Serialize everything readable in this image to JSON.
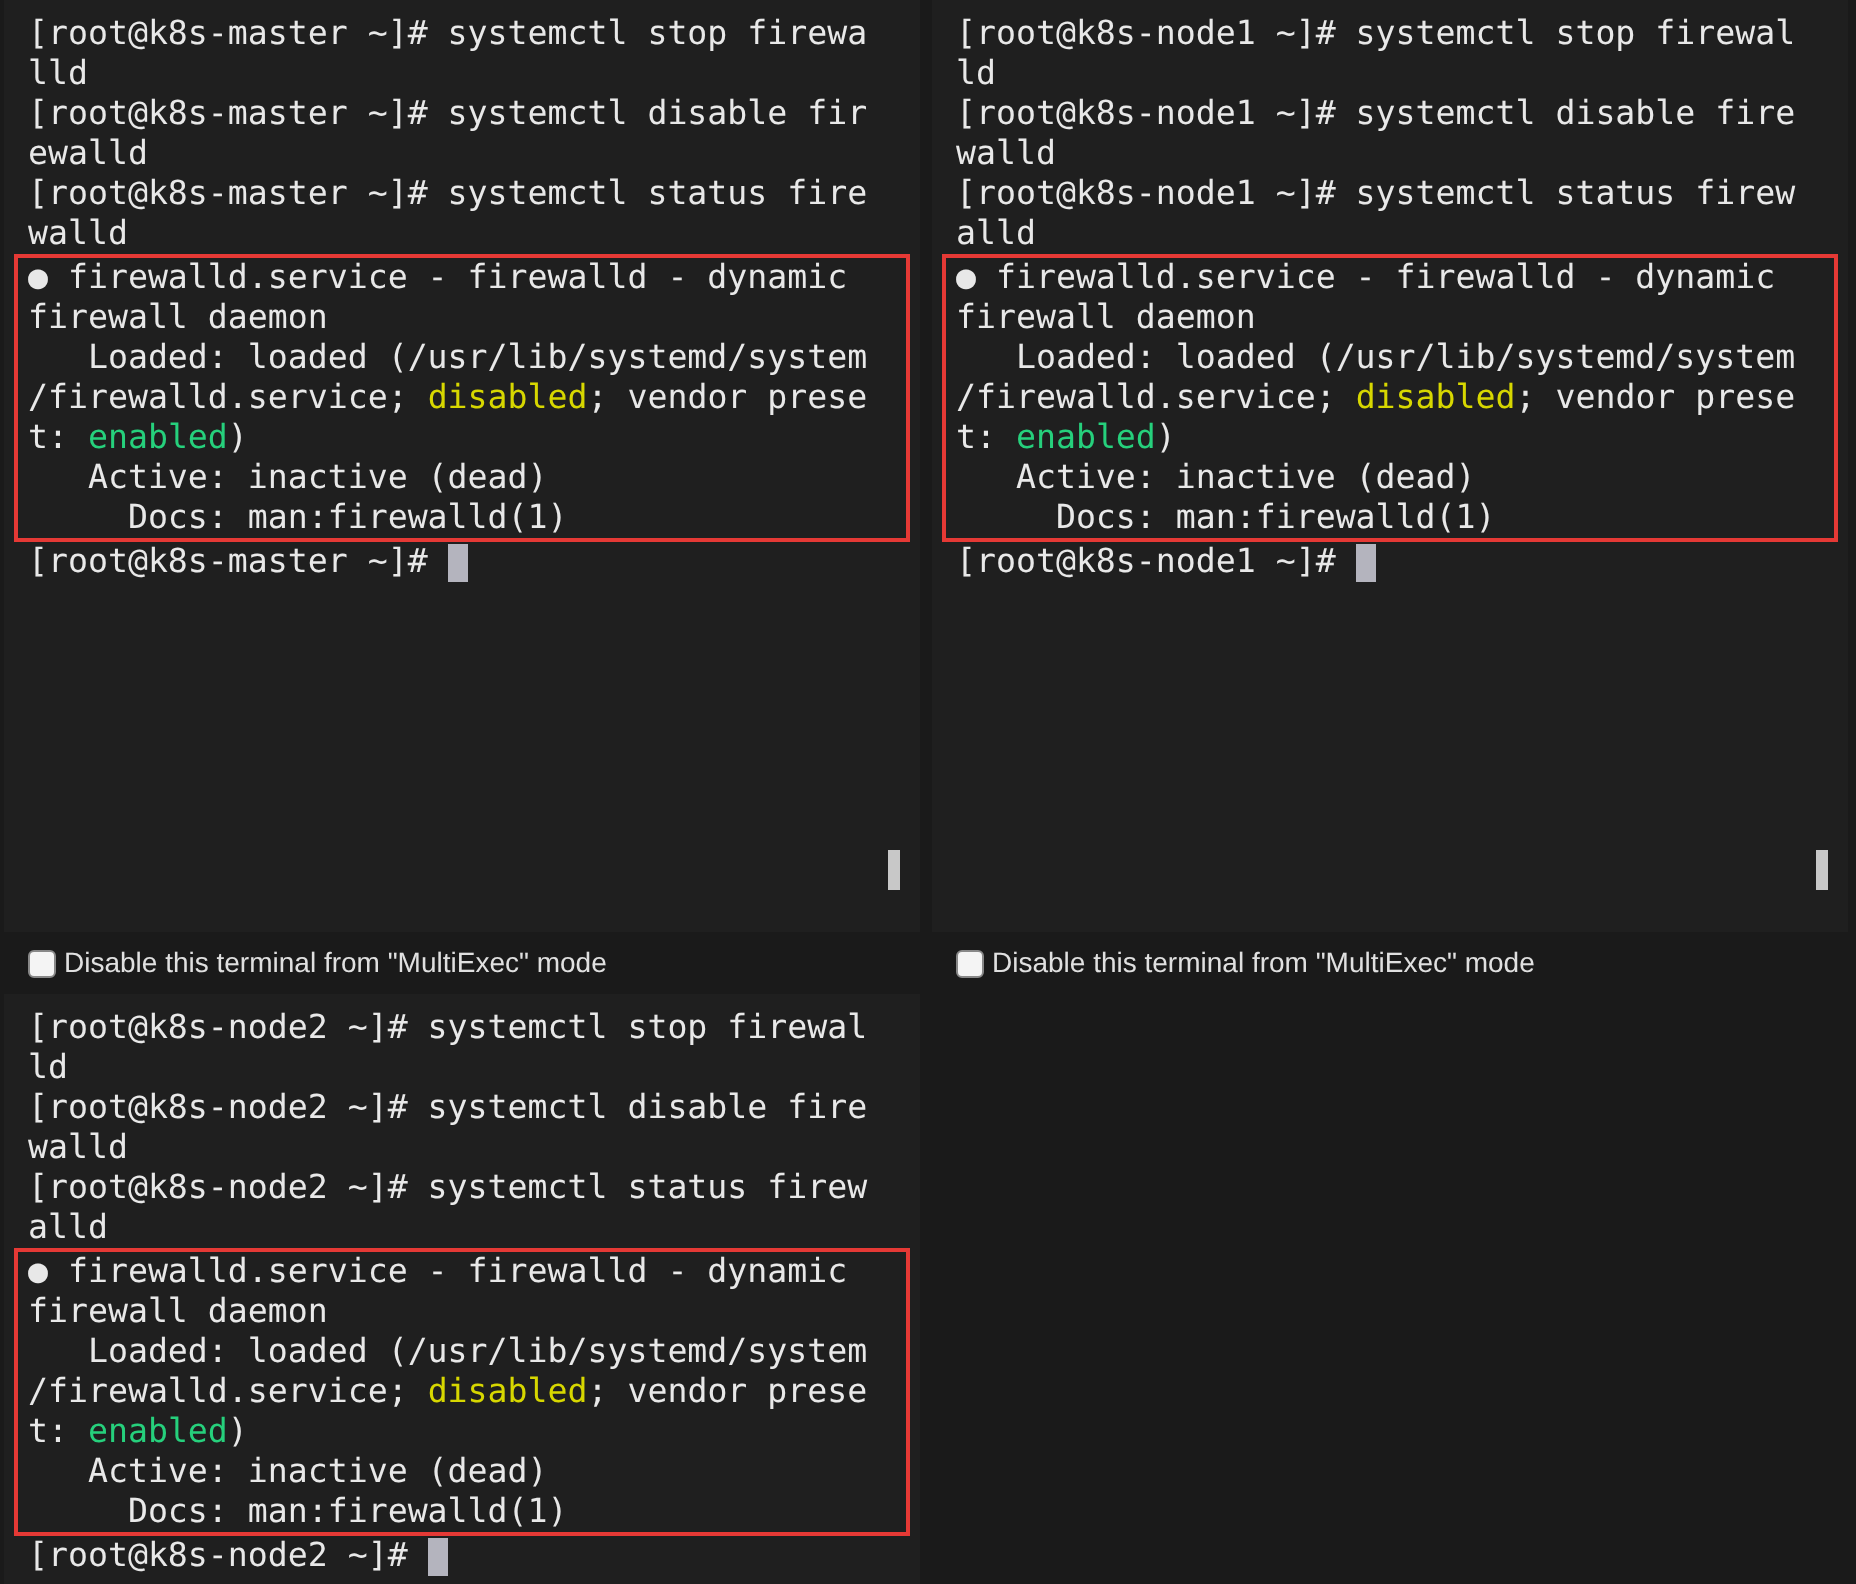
{
  "terminals": [
    {
      "lines": [
        [
          {
            "kind": "text",
            "text": "[root@k8s-master ~]# systemctl stop firewa"
          }
        ],
        [
          {
            "kind": "text",
            "text": "lld"
          }
        ],
        [
          {
            "kind": "text",
            "text": "[root@k8s-master ~]# systemctl disable fir"
          }
        ],
        [
          {
            "kind": "text",
            "text": "ewalld"
          }
        ],
        [
          {
            "kind": "text",
            "text": "[root@k8s-master ~]# systemctl status fire"
          }
        ],
        [
          {
            "kind": "text",
            "text": "walld"
          }
        ]
      ],
      "highlighted_lines": [
        [
          {
            "kind": "text",
            "text": "● firewalld.service - firewalld - dynamic"
          }
        ],
        [
          {
            "kind": "text",
            "text": "firewall daemon"
          }
        ],
        [
          {
            "kind": "text",
            "text": "   Loaded: loaded (/usr/lib/systemd/system"
          }
        ],
        [
          {
            "kind": "text",
            "text": "/firewalld.service; "
          },
          {
            "kind": "warning",
            "text": "disabled"
          },
          {
            "kind": "text",
            "text": "; vendor prese"
          }
        ],
        [
          {
            "kind": "text",
            "text": "t: "
          },
          {
            "kind": "success",
            "text": "enabled"
          },
          {
            "kind": "text",
            "text": ")"
          }
        ],
        [
          {
            "kind": "text",
            "text": "   Active: inactive (dead)"
          }
        ],
        [
          {
            "kind": "text",
            "text": "     Docs: man:firewalld(1)"
          }
        ]
      ],
      "prompt": "[root@k8s-master ~]# ",
      "cursor": true,
      "multiexec_checkbox": {
        "label": "Disable this terminal from \"MultiExec\" mode",
        "checked": false
      }
    },
    {
      "lines": [
        [
          {
            "kind": "text",
            "text": "[root@k8s-node1 ~]# systemctl stop firewal"
          }
        ],
        [
          {
            "kind": "text",
            "text": "ld"
          }
        ],
        [
          {
            "kind": "text",
            "text": "[root@k8s-node1 ~]# systemctl disable fire"
          }
        ],
        [
          {
            "kind": "text",
            "text": "walld"
          }
        ],
        [
          {
            "kind": "text",
            "text": "[root@k8s-node1 ~]# systemctl status firew"
          }
        ],
        [
          {
            "kind": "text",
            "text": "alld"
          }
        ]
      ],
      "highlighted_lines": [
        [
          {
            "kind": "text",
            "text": "● firewalld.service - firewalld - dynamic"
          }
        ],
        [
          {
            "kind": "text",
            "text": "firewall daemon"
          }
        ],
        [
          {
            "kind": "text",
            "text": "   Loaded: loaded (/usr/lib/systemd/system"
          }
        ],
        [
          {
            "kind": "text",
            "text": "/firewalld.service; "
          },
          {
            "kind": "warning",
            "text": "disabled"
          },
          {
            "kind": "text",
            "text": "; vendor prese"
          }
        ],
        [
          {
            "kind": "text",
            "text": "t: "
          },
          {
            "kind": "success",
            "text": "enabled"
          },
          {
            "kind": "text",
            "text": ")"
          }
        ],
        [
          {
            "kind": "text",
            "text": "   Active: inactive (dead)"
          }
        ],
        [
          {
            "kind": "text",
            "text": "     Docs: man:firewalld(1)"
          }
        ]
      ],
      "prompt": "[root@k8s-node1 ~]# ",
      "cursor": true,
      "multiexec_checkbox": {
        "label": "Disable this terminal from \"MultiExec\" mode",
        "checked": false
      }
    },
    {
      "lines": [
        [
          {
            "kind": "text",
            "text": "[root@k8s-node2 ~]# systemctl stop firewal"
          }
        ],
        [
          {
            "kind": "text",
            "text": "ld"
          }
        ],
        [
          {
            "kind": "text",
            "text": "[root@k8s-node2 ~]# systemctl disable fire"
          }
        ],
        [
          {
            "kind": "text",
            "text": "walld"
          }
        ],
        [
          {
            "kind": "text",
            "text": "[root@k8s-node2 ~]# systemctl status firew"
          }
        ],
        [
          {
            "kind": "text",
            "text": "alld"
          }
        ]
      ],
      "highlighted_lines": [
        [
          {
            "kind": "text",
            "text": "● firewalld.service - firewalld - dynamic"
          }
        ],
        [
          {
            "kind": "text",
            "text": "firewall daemon"
          }
        ],
        [
          {
            "kind": "text",
            "text": "   Loaded: loaded (/usr/lib/systemd/system"
          }
        ],
        [
          {
            "kind": "text",
            "text": "/firewalld.service; "
          },
          {
            "kind": "warning",
            "text": "disabled"
          },
          {
            "kind": "text",
            "text": "; vendor prese"
          }
        ],
        [
          {
            "kind": "text",
            "text": "t: "
          },
          {
            "kind": "success",
            "text": "enabled"
          },
          {
            "kind": "text",
            "text": ")"
          }
        ],
        [
          {
            "kind": "text",
            "text": "   Active: inactive (dead)"
          }
        ],
        [
          {
            "kind": "text",
            "text": "     Docs: man:firewalld(1)"
          }
        ]
      ],
      "prompt": "[root@k8s-node2 ~]# ",
      "cursor": true
    }
  ]
}
